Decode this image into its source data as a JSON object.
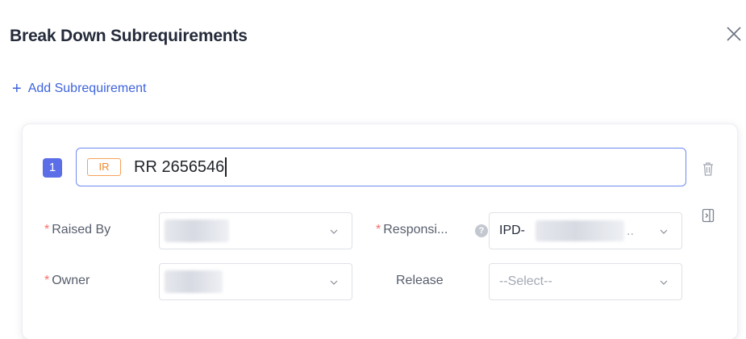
{
  "dialog": {
    "title": "Break Down Subrequirements",
    "close_icon": "close-icon"
  },
  "add_subrequirement": {
    "icon": "plus-icon",
    "label": "Add Subrequirement"
  },
  "subrequirement": {
    "index": "1",
    "type_tag": "IR",
    "title_value": "RR 2656546",
    "fields": {
      "raised_by": {
        "label": "Raised By",
        "required": true,
        "value": ""
      },
      "responsible": {
        "label": "Responsi...",
        "required": true,
        "value": "IPD-",
        "value_suffix": "..",
        "help_icon": "help-icon"
      },
      "owner": {
        "label": "Owner",
        "required": true,
        "value": ""
      },
      "release": {
        "label": "Release",
        "required": false,
        "placeholder": "--Select--"
      }
    },
    "actions": {
      "delete_icon": "trash-icon",
      "expand_icon": "panel-expand-icon"
    }
  },
  "colors": {
    "accent": "#3e63dd",
    "badge": "#5b6ee8",
    "tag_orange": "#f08a2e",
    "required": "#f66f6a"
  }
}
